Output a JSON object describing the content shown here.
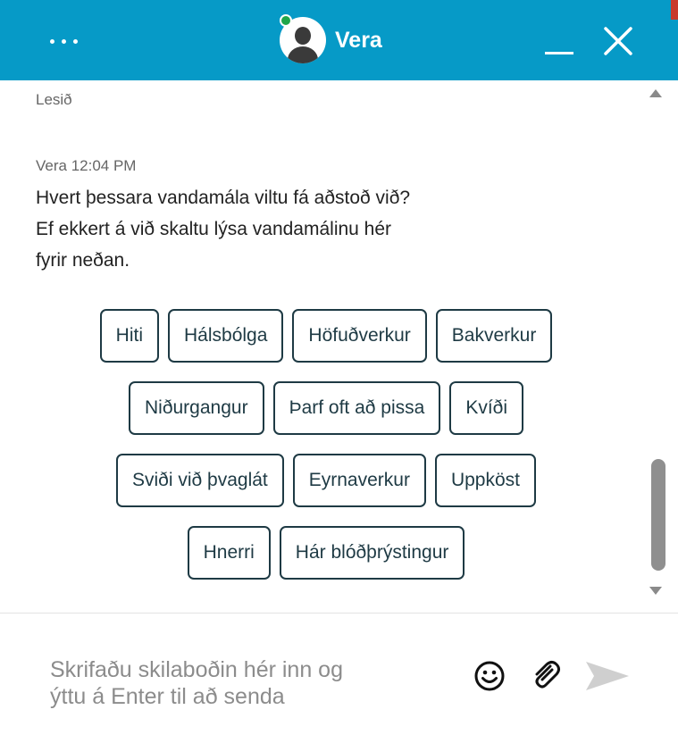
{
  "header": {
    "agent_name": "Vera",
    "background_color": "#069ac7",
    "status_color": "#1fa64a",
    "icons": [
      "more-options-icon",
      "avatar-icon",
      "minimize-icon",
      "close-icon"
    ]
  },
  "transcript": {
    "read_status": "Lesið",
    "message": {
      "sender_time": "Vera 12:04 PM",
      "lines": [
        "Hvert þessara vandamála viltu fá aðstoð við?",
        "Ef ekkert á við skaltu lýsa vandamálinu hér",
        "fyrir neðan."
      ]
    },
    "quick_replies": [
      [
        "Hiti",
        "Hálsbólga",
        "Höfuðverkur",
        "Bakverkur"
      ],
      [
        "Niðurgangur",
        "Þarf oft að pissa",
        "Kvíði"
      ],
      [
        "Sviði við þvaglát",
        "Eyrnaverkur",
        "Uppköst"
      ],
      [
        "Hnerri",
        "Hár blóðþrýstingur"
      ]
    ]
  },
  "composer": {
    "placeholder_lines": [
      "Skrifaðu skilaboðin hér inn og",
      "ýttu á Enter til að senda"
    ],
    "icons": [
      "emoji-icon",
      "attach-icon",
      "send-icon"
    ]
  }
}
